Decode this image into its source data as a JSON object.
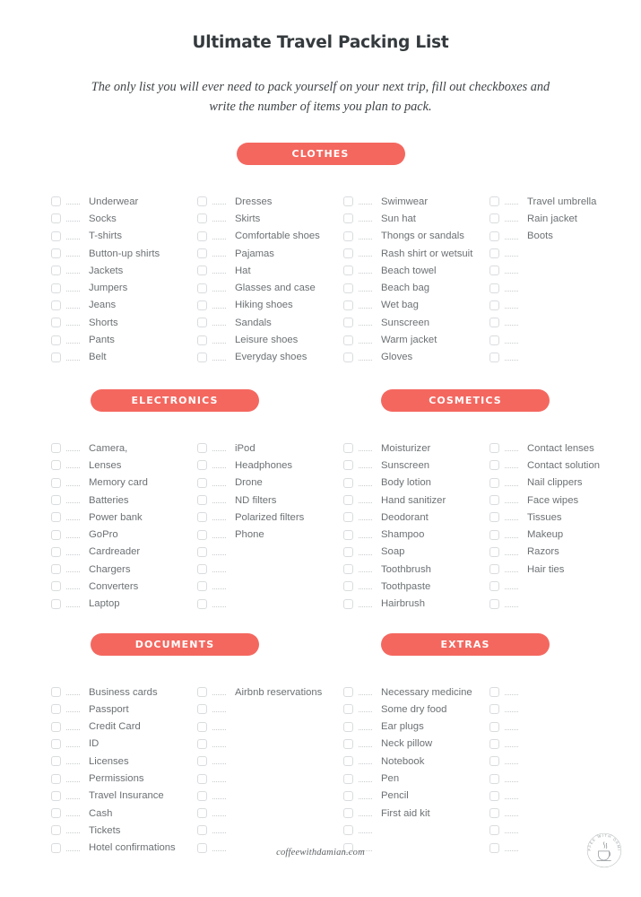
{
  "header": {
    "title": "Ultimate Travel Packing List",
    "subtitle": "The only list you will ever need to pack yourself on your next trip, fill out checkboxes and write the number of items you plan to pack."
  },
  "colors": {
    "badge_background": "#f4675f",
    "badge_text": "#ffffff",
    "title_text": "#343a3d",
    "item_text": "#6c7174",
    "checkbox_border": "#d9dcde",
    "page_background": "#ffffff"
  },
  "sections": [
    {
      "id": "clothes",
      "label": "CLOTHES",
      "columns": [
        [
          "Underwear",
          "Socks",
          "T-shirts",
          "Button-up shirts",
          "Jackets",
          "Jumpers",
          "Jeans",
          "Shorts",
          "Pants",
          "Belt"
        ],
        [
          "Dresses",
          "Skirts",
          "Comfortable shoes",
          "Pajamas",
          "Hat",
          "Glasses and case",
          "Hiking shoes",
          "Sandals",
          "Leisure shoes",
          "Everyday shoes"
        ],
        [
          "Swimwear",
          "Sun hat",
          "Thongs or sandals",
          "Rash shirt or wetsuit",
          "Beach towel",
          "Beach bag",
          "Wet bag",
          "Sunscreen",
          "Warm jacket",
          "Gloves"
        ],
        [
          "Travel umbrella",
          "Rain jacket",
          "Boots",
          "",
          "",
          "",
          "",
          "",
          "",
          ""
        ]
      ]
    },
    {
      "id": "electronics",
      "label": "ELECTRONICS",
      "columns": [
        [
          "Camera,",
          "Lenses",
          "Memory card",
          "Batteries",
          "Power bank",
          "GoPro",
          "Cardreader",
          "Chargers",
          "Converters",
          "Laptop"
        ],
        [
          "iPod",
          "Headphones",
          "Drone",
          "ND filters",
          "Polarized filters",
          "Phone",
          "",
          "",
          "",
          ""
        ]
      ]
    },
    {
      "id": "cosmetics",
      "label": "COSMETICS",
      "columns": [
        [
          "Moisturizer",
          "Sunscreen",
          "Body lotion",
          "Hand sanitizer",
          "Deodorant",
          "Shampoo",
          "Soap",
          "Toothbrush",
          "Toothpaste",
          "Hairbrush"
        ],
        [
          "Contact lenses",
          "Contact solution",
          "Nail clippers",
          "Face wipes",
          "Tissues",
          "Makeup",
          "Razors",
          "Hair ties",
          "",
          ""
        ]
      ]
    },
    {
      "id": "documents",
      "label": "DOCUMENTS",
      "columns": [
        [
          "Business cards",
          "Passport",
          "Credit Card",
          "ID",
          "Licenses",
          "Permissions",
          "Travel Insurance",
          "Cash",
          "Tickets",
          "Hotel confirmations"
        ],
        [
          "Airbnb reservations",
          "",
          "",
          "",
          "",
          "",
          "",
          "",
          "",
          ""
        ]
      ]
    },
    {
      "id": "extras",
      "label": "EXTRAS",
      "columns": [
        [
          "Necessary medicine",
          "Some dry food",
          "Ear plugs",
          "Neck pillow",
          "Notebook",
          "Pen",
          "Pencil",
          "First aid kit",
          "",
          ""
        ],
        [
          "",
          "",
          "",
          "",
          "",
          "",
          "",
          "",
          "",
          ""
        ]
      ]
    }
  ],
  "footer": {
    "url": "coffeewithdamian.com",
    "logo_name": "coffee-with-damian-logo",
    "logo_ring_text": "COFFEE WITH DAMIAN"
  }
}
